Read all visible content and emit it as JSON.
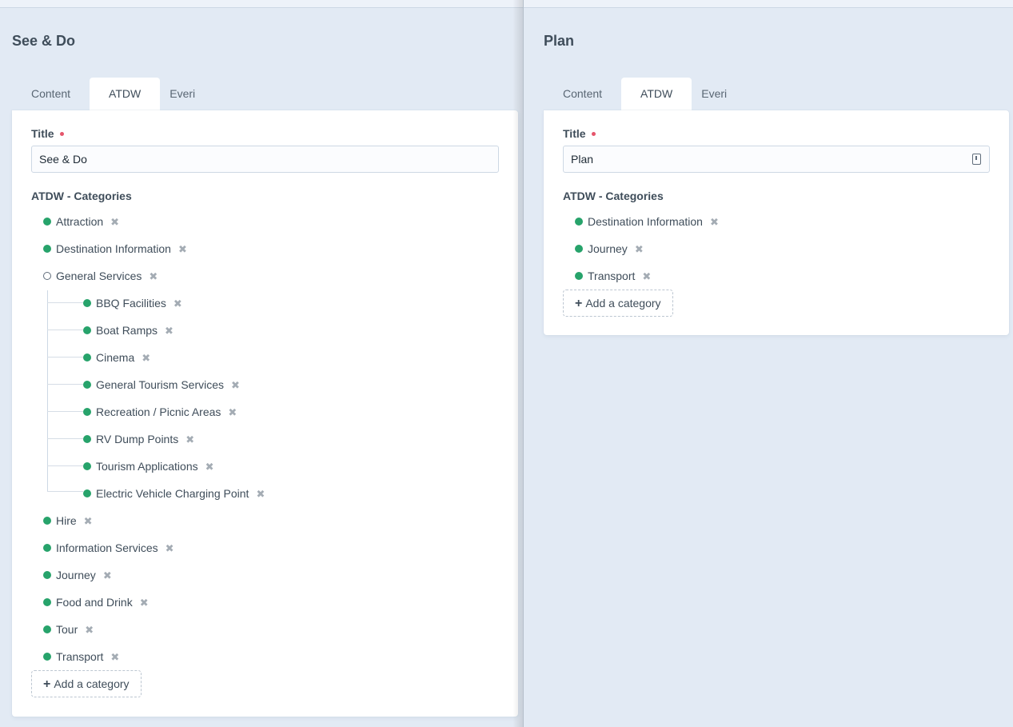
{
  "left_pane": {
    "title": "See & Do",
    "tabs": [
      {
        "label": "Content"
      },
      {
        "label": "ATDW"
      },
      {
        "label": "Everi"
      }
    ],
    "title_field": {
      "label": "Title",
      "value": "See & Do"
    },
    "categories_label": "ATDW - Categories",
    "categories": [
      {
        "label": "Attraction"
      },
      {
        "label": "Destination Information"
      },
      {
        "label": "General Services"
      },
      {
        "label": "BBQ Facilities"
      },
      {
        "label": "Boat Ramps"
      },
      {
        "label": "Cinema"
      },
      {
        "label": "General Tourism Services"
      },
      {
        "label": "Recreation / Picnic Areas"
      },
      {
        "label": "RV Dump Points"
      },
      {
        "label": "Tourism Applications"
      },
      {
        "label": "Electric Vehicle Charging Point"
      },
      {
        "label": "Hire"
      },
      {
        "label": "Information Services"
      },
      {
        "label": "Journey"
      },
      {
        "label": "Food and Drink"
      },
      {
        "label": "Tour"
      },
      {
        "label": "Transport"
      }
    ],
    "add_label": "Add a category"
  },
  "right_pane": {
    "title": "Plan",
    "tabs": [
      {
        "label": "Content"
      },
      {
        "label": "ATDW"
      },
      {
        "label": "Everi"
      }
    ],
    "title_field": {
      "label": "Title",
      "value": "Plan"
    },
    "categories_label": "ATDW - Categories",
    "categories": [
      {
        "label": "Destination Information"
      },
      {
        "label": "Journey"
      },
      {
        "label": "Transport"
      }
    ],
    "add_label": "Add a category"
  },
  "colors": {
    "selected_dot": "#27a36b",
    "required": "#e5556b",
    "background": "#e2eaf4"
  },
  "icons": {
    "remove": "cross-icon",
    "add": "plus-icon",
    "input_action": "document-icon"
  }
}
